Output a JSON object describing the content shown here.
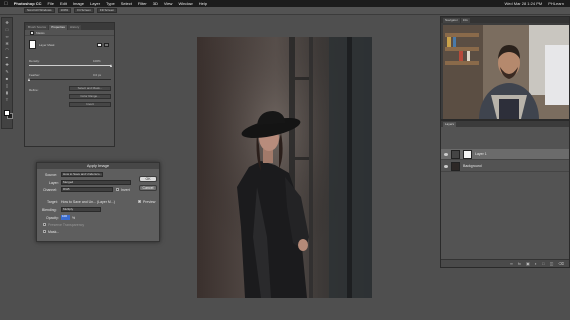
{
  "menubar": {
    "apple": "",
    "items": [
      "Photoshop CC",
      "File",
      "Edit",
      "Image",
      "Layer",
      "Type",
      "Select",
      "Filter",
      "3D",
      "View",
      "Window",
      "Help"
    ],
    "clock": "Wed Mar 28  1:24 PM",
    "user": "PHLearn"
  },
  "optionsbar": {
    "buttons": [
      "Scroll All Windows",
      "100%",
      "Fit Screen",
      "Fill Screen"
    ]
  },
  "properties_panel": {
    "tabs": [
      "Brush Source",
      "Properties",
      "History"
    ],
    "section_title": "Masks",
    "mask_label": "Layer Mask",
    "density_label": "Density:",
    "density_value": "100%",
    "density_fraction": 1.0,
    "feather_label": "Feather:",
    "feather_value": "0.0 px",
    "feather_fraction": 0.0,
    "refine_label": "Refine:",
    "select_mask_button": "Select and Mask...",
    "color_range_button": "Color Range...",
    "invert_button": "Invert"
  },
  "apply_image": {
    "title": "Apply Image",
    "source_label": "Source:",
    "source_value": "How to Save and Undersco...",
    "layer_label": "Layer:",
    "layer_value": "Merged",
    "channel_label": "Channel:",
    "channel_value": "RGB",
    "invert_label": "Invert",
    "target_label": "Target:",
    "target_value": "How to Save and Un... (Layer M...)",
    "blending_label": "Blending:",
    "blending_value": "Multiply",
    "opacity_label": "Opacity:",
    "opacity_value": "100",
    "opacity_unit": "%",
    "preserve_label": "Preserve Transparency",
    "mask_label": "Mask...",
    "ok_button": "OK",
    "cancel_button": "Cancel",
    "preview_label": "Preview"
  },
  "navigator_panel": {
    "tabs": [
      "Navigator",
      "Info"
    ]
  },
  "layers_panel": {
    "tabs": [
      "Layers"
    ],
    "layers": [
      {
        "name": "Layer 1",
        "selected": true
      },
      {
        "name": "Background",
        "selected": false
      }
    ]
  },
  "colors": {
    "workspace": "#4f4f4f",
    "panel": "#535353",
    "accent": "#3a6cd0"
  }
}
